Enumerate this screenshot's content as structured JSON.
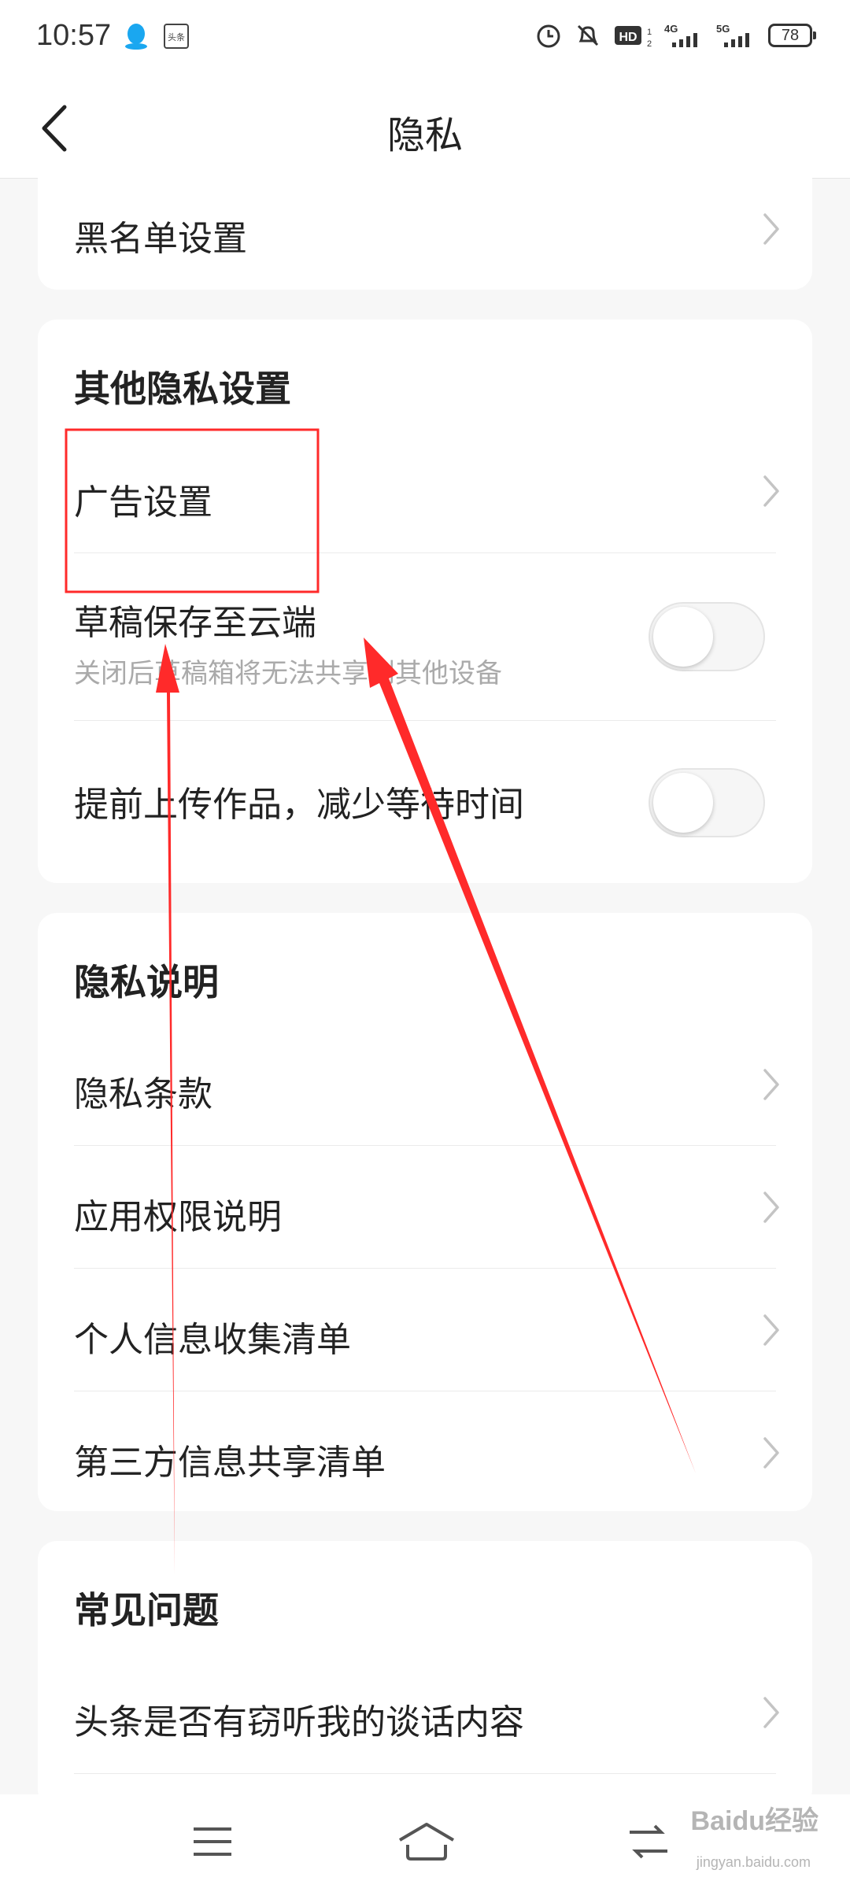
{
  "status_bar": {
    "time": "10:57",
    "icons": [
      "qq-icon",
      "toutiao-icon",
      "alarm-icon",
      "mute-icon",
      "hd-icon",
      "signal-4g-icon",
      "signal-5g-icon",
      "battery-icon"
    ],
    "hd_label": "HD",
    "net1": "4G",
    "net2": "5G",
    "battery": "78"
  },
  "nav": {
    "title": "隐私"
  },
  "section_top": {
    "rows": [
      {
        "label": "黑名单设置"
      }
    ]
  },
  "section_other": {
    "header": "其他隐私设置",
    "rows": [
      {
        "label": "广告设置"
      },
      {
        "label": "草稿保存至云端",
        "sub": "关闭后草稿箱将无法共享到其他设备",
        "toggle": "off"
      },
      {
        "label": "提前上传作品，减少等待时间",
        "toggle": "off"
      }
    ]
  },
  "section_explain": {
    "header": "隐私说明",
    "rows": [
      {
        "label": "隐私条款"
      },
      {
        "label": "应用权限说明"
      },
      {
        "label": "个人信息收集清单"
      },
      {
        "label": "第三方信息共享清单"
      }
    ]
  },
  "section_faq": {
    "header": "常见问题",
    "rows": [
      {
        "label": "头条是否有窃听我的谈话内容"
      }
    ]
  },
  "bottom_nav": {
    "icons": [
      "menu-icon",
      "home-icon",
      "back-switch-icon"
    ]
  },
  "watermark": {
    "text": "Baidu经验",
    "sub": "jingyan.baidu.com"
  },
  "colors": {
    "annotation": "#ff2a2a",
    "background": "#f7f7f7"
  }
}
